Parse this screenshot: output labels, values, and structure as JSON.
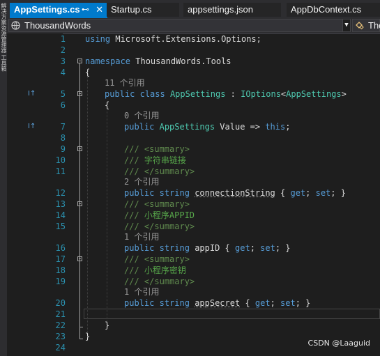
{
  "toolstrip": {
    "text": "解决方案资源管理器 工具箱"
  },
  "tabs": [
    {
      "label": "AppSettings.cs",
      "pin": "⊷",
      "close": "✕",
      "active": true
    },
    {
      "label": "Startup.cs",
      "active": false
    },
    {
      "label": "appsettings.json",
      "active": false
    },
    {
      "label": "AppDbContext.cs",
      "active": false
    }
  ],
  "navbar": {
    "project": "ThousandWords",
    "member": "Tho"
  },
  "line_numbers": [
    "1",
    "2",
    "3",
    "4",
    "5",
    "6",
    "7",
    "8",
    "9",
    "10",
    "11",
    "12",
    "13",
    "14",
    "15",
    "16",
    "17",
    "18",
    "19",
    "20",
    "21",
    "22",
    "23",
    "24"
  ],
  "code": {
    "l1": {
      "kw": "using",
      "rest": " Microsoft.Extensions.Options;"
    },
    "l3": {
      "kw": "namespace",
      "rest": " ThousandWords.Tools"
    },
    "l4": "{",
    "ref5": "11 个引用",
    "l5": {
      "kw1": "public",
      "kw2": "class",
      "type": "AppSettings",
      "sep": " : ",
      "iface": "IOptions",
      "lt": "<",
      "targ": "AppSettings",
      "gt": ">"
    },
    "l6": "{",
    "ref7": "0 个引用",
    "l7": {
      "kw1": "public",
      "type": "AppSettings",
      "name": " Value => ",
      "kw2": "this",
      "end": ";"
    },
    "l9": {
      "doc": "///",
      "tag": " <summary>"
    },
    "l10": {
      "doc": "///",
      "text": " 字符串链接"
    },
    "l11": {
      "doc": "///",
      "tag": " </summary>"
    },
    "ref12": "2 个引用",
    "l12": {
      "kw1": "public",
      "kw2": "string",
      "name": "connectionString",
      "b1": " { ",
      "get": "get",
      "semi1": "; ",
      "set": "set",
      "semi2": "; }"
    },
    "l13": {
      "doc": "///",
      "tag": " <summary>"
    },
    "l14": {
      "doc": "///",
      "text": " 小程序APPID"
    },
    "l15": {
      "doc": "///",
      "tag": " </summary>"
    },
    "ref16": "1 个引用",
    "l16": {
      "kw1": "public",
      "kw2": "string",
      "name": "appID",
      "b1": " { ",
      "get": "get",
      "semi1": "; ",
      "set": "set",
      "semi2": "; }"
    },
    "l17": {
      "doc": "///",
      "tag": " <summary>"
    },
    "l18": {
      "doc": "///",
      "text": " 小程序密钥"
    },
    "l19": {
      "doc": "///",
      "tag": " </summary>"
    },
    "ref20": "1 个引用",
    "l20": {
      "kw1": "public",
      "kw2": "string",
      "name": "appSecret",
      "b1": " { ",
      "get": "get",
      "semi1": "; ",
      "set": "set",
      "semi2": "; }"
    },
    "l22": "}",
    "l23": "}"
  },
  "glyphs": {
    "impl": "I↑"
  },
  "watermark": "CSDN @Laaguid",
  "colors": {
    "accent": "#007acc",
    "keyword": "#569cd6",
    "type": "#4ec9b0",
    "comment": "#57a64a",
    "linenumber": "#2b91af"
  }
}
